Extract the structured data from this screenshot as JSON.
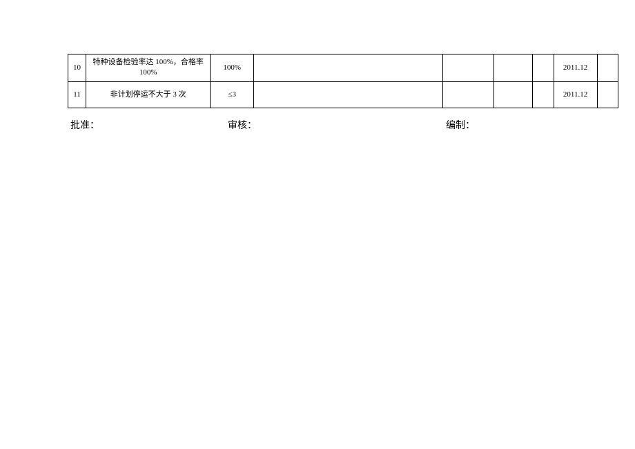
{
  "table": {
    "rows": [
      {
        "num": "10",
        "desc": "特种设备检验率达 100%，合格率100%",
        "val": "100%",
        "c4": "",
        "c5": "",
        "c6": "",
        "c7": "",
        "c8": "2011.12",
        "c9": ""
      },
      {
        "num": "11",
        "desc": "非计划停运不大于 3 次",
        "val": "≤3",
        "c4": "",
        "c5": "",
        "c6": "",
        "c7": "",
        "c8": "2011.12",
        "c9": ""
      }
    ]
  },
  "footer": {
    "approve": "批准：",
    "review": "审核：",
    "compile": "编制："
  }
}
